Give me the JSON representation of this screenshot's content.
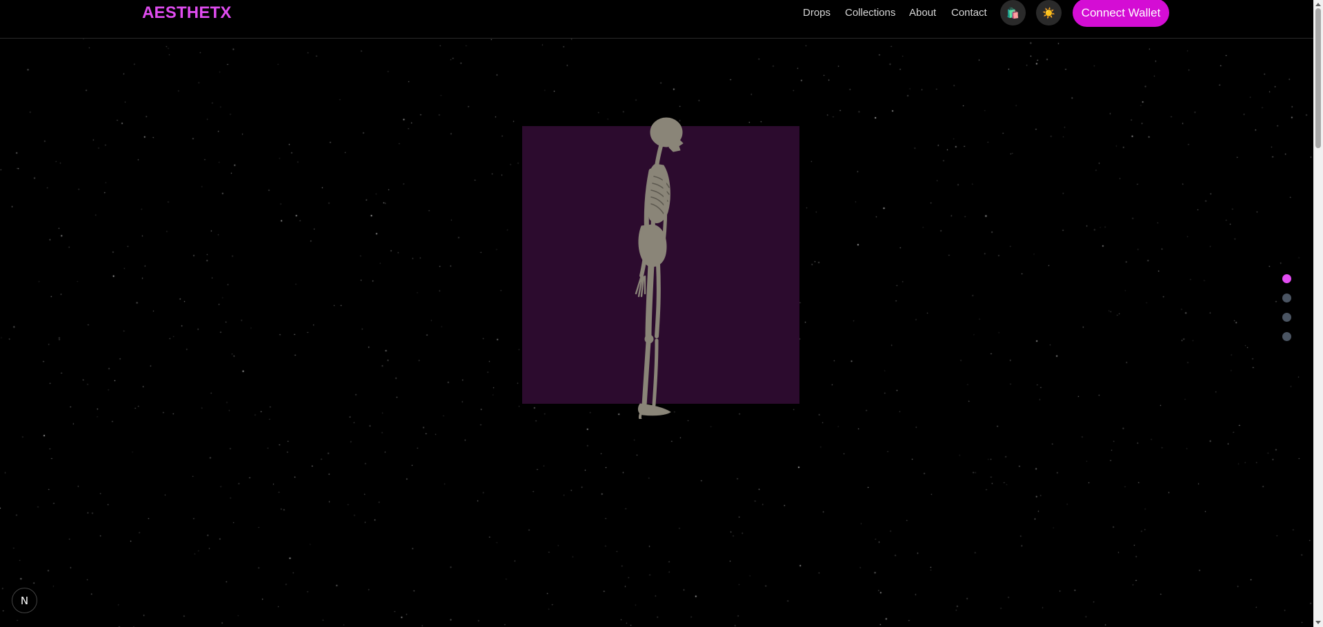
{
  "header": {
    "logo": "AESTHETX",
    "nav": [
      "Drops",
      "Collections",
      "About",
      "Contact"
    ],
    "bag_icon": "🛍️",
    "theme_icon": "☀️",
    "connect_label": "Connect Wallet"
  },
  "hero": {
    "figure": "skeleton-figure"
  },
  "section_dots": {
    "count": 4,
    "active_index": 0
  },
  "badge": {
    "glyph": "N"
  },
  "colors": {
    "background": "#000000",
    "accent": "#d40dd4",
    "logo": "#e04cf0",
    "panel": "#2c0b2e",
    "bone": "#8a8578",
    "dot_active": "#e24df2",
    "dot_inactive": "#4b5563"
  }
}
